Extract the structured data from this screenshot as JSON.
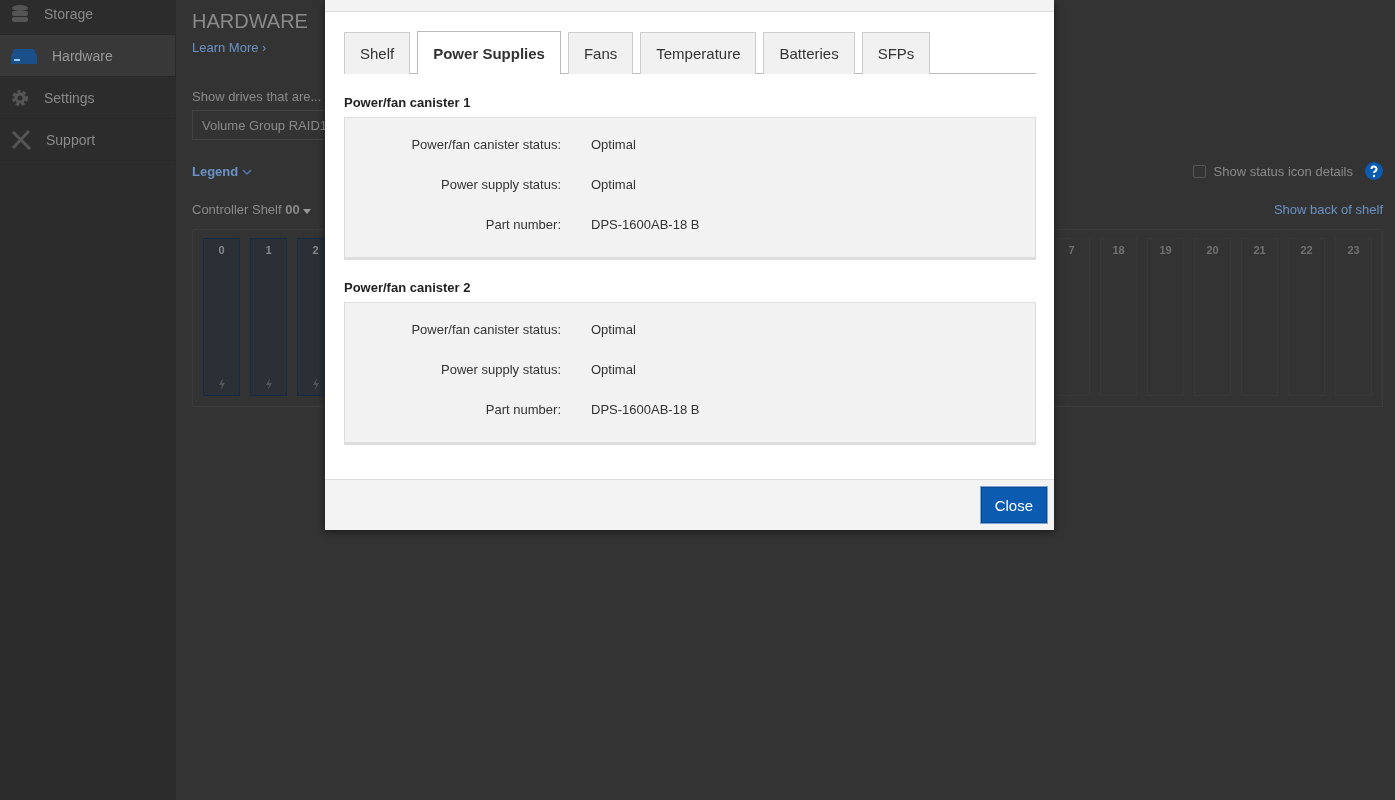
{
  "sidebar": {
    "items": [
      {
        "label": "Storage",
        "selected": false
      },
      {
        "label": "Hardware",
        "selected": true
      },
      {
        "label": "Settings",
        "selected": false
      },
      {
        "label": "Support",
        "selected": false
      }
    ]
  },
  "page": {
    "title": "HARDWARE",
    "learn_more": "Learn More ›",
    "filter_label": "Show drives that are...",
    "filter_value": "Volume Group RAID1",
    "legend": "Legend",
    "show_status_details": {
      "label": "Show status icon details",
      "checked": false
    },
    "shelf_label": "Controller Shelf",
    "shelf_number": "00",
    "show_back": "Show back of shelf",
    "slots_left": [
      {
        "label": "0",
        "kind": "drive"
      },
      {
        "label": "1",
        "kind": "drive"
      },
      {
        "label": "2",
        "kind": "drive"
      }
    ],
    "slots_right": [
      {
        "label": "7",
        "kind": "empty"
      },
      {
        "label": "18",
        "kind": "empty"
      },
      {
        "label": "19",
        "kind": "empty"
      },
      {
        "label": "20",
        "kind": "empty"
      },
      {
        "label": "21",
        "kind": "empty"
      },
      {
        "label": "22",
        "kind": "empty"
      },
      {
        "label": "23",
        "kind": "empty"
      }
    ]
  },
  "dialog": {
    "tabs": [
      {
        "label": "Shelf",
        "selected": false
      },
      {
        "label": "Power Supplies",
        "selected": true
      },
      {
        "label": "Fans",
        "selected": false
      },
      {
        "label": "Temperature",
        "selected": false
      },
      {
        "label": "Batteries",
        "selected": false
      },
      {
        "label": "SFPs",
        "selected": false
      }
    ],
    "sections": [
      {
        "title": "Power/fan canister 1",
        "fields": [
          {
            "label": "Power/fan canister status:",
            "value": "Optimal"
          },
          {
            "label": "Power supply status:",
            "value": "Optimal"
          },
          {
            "label": "Part number:",
            "value": "DPS-1600AB-18 B"
          }
        ]
      },
      {
        "title": "Power/fan canister 2",
        "fields": [
          {
            "label": "Power/fan canister status:",
            "value": "Optimal"
          },
          {
            "label": "Power supply status:",
            "value": "Optimal"
          },
          {
            "label": "Part number:",
            "value": "DPS-1600AB-18 B"
          }
        ]
      }
    ],
    "close": "Close"
  }
}
